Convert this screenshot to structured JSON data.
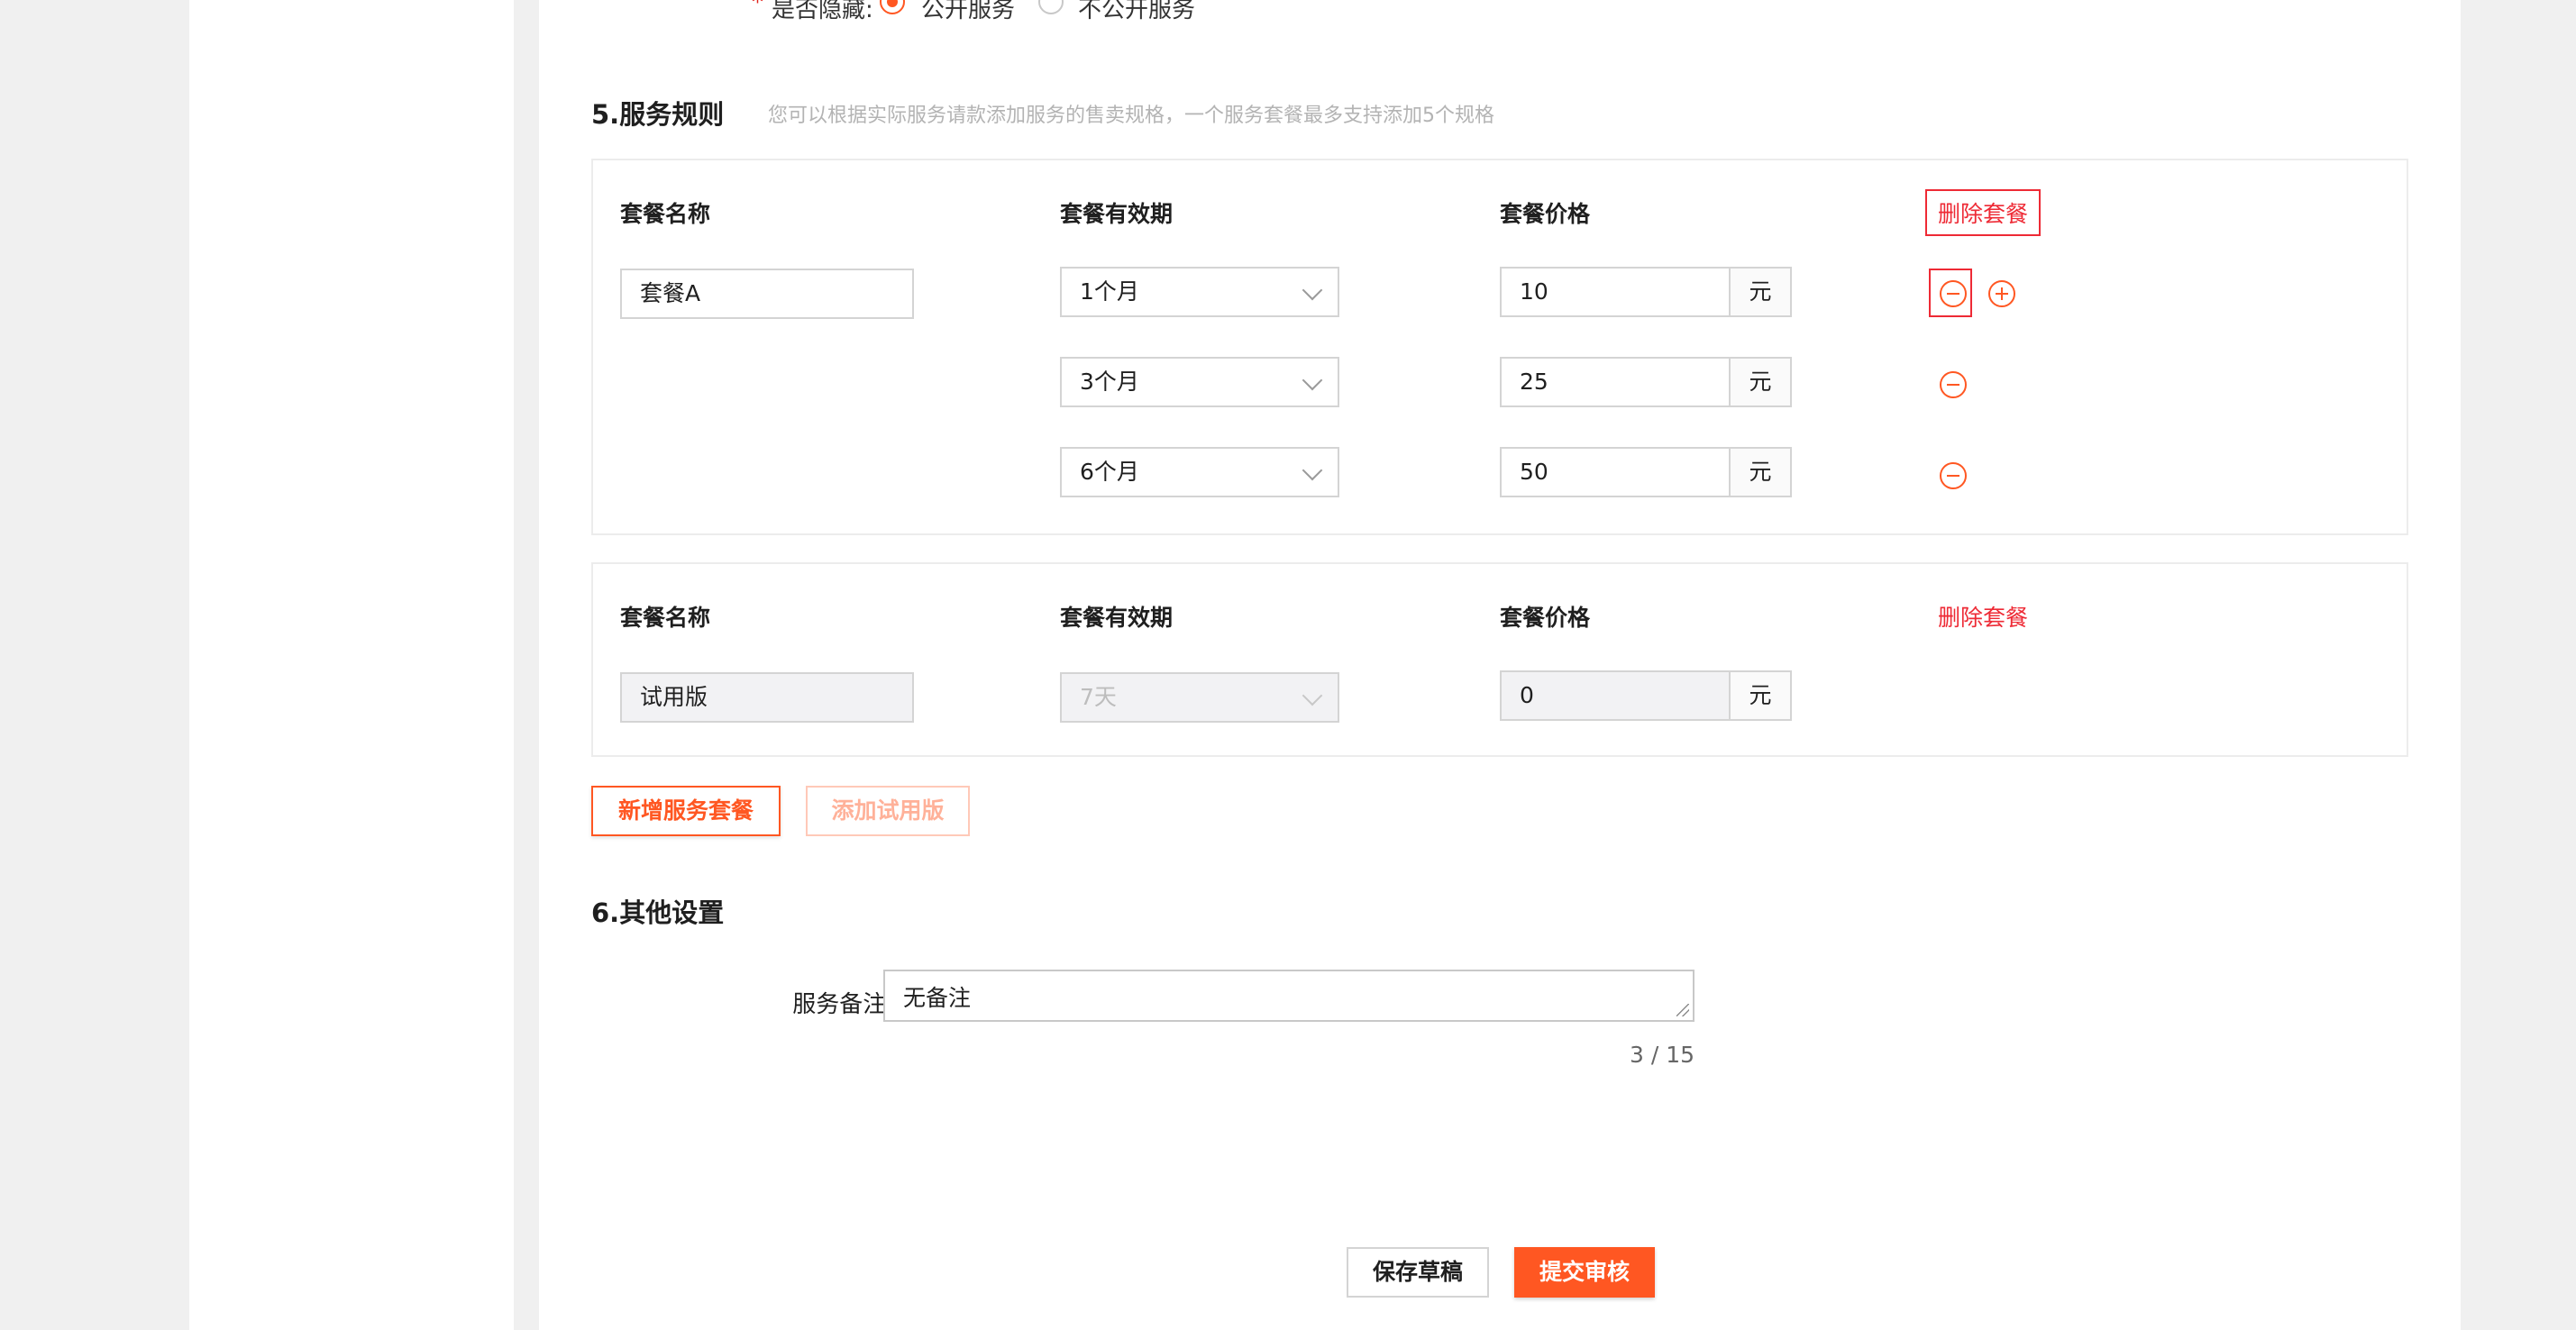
{
  "hidden_row": {
    "required_mark": "*",
    "label": "是否隐藏:",
    "options": [
      "公开服务",
      "不公开服务"
    ],
    "selected_index": 0
  },
  "section5": {
    "title": "5.服务规则",
    "hint": "您可以根据实际服务请款添加服务的售卖规格，一个服务套餐最多支持添加5个规格"
  },
  "package_a": {
    "col_name": "套餐名称",
    "col_period": "套餐有效期",
    "col_price": "套餐价格",
    "delete_label": "删除套餐",
    "name_value": "套餐A",
    "specs": [
      {
        "period": "1个月",
        "price": "10",
        "unit": "元"
      },
      {
        "period": "3个月",
        "price": "25",
        "unit": "元"
      },
      {
        "period": "6个月",
        "price": "50",
        "unit": "元"
      }
    ]
  },
  "package_trial": {
    "col_name": "套餐名称",
    "col_period": "套餐有效期",
    "col_price": "套餐价格",
    "delete_label": "删除套餐",
    "name_value": "试用版",
    "period_value": "7天",
    "price_value": "0",
    "unit": "元"
  },
  "actions": {
    "add_package": "新增服务套餐",
    "add_trial": "添加试用版"
  },
  "section6": {
    "title": "6.其他设置",
    "remark_label": "服务备注:",
    "remark_value": "无备注",
    "counter": "3 / 15"
  },
  "footer": {
    "save_draft": "保存草稿",
    "submit": "提交审核"
  },
  "colors": {
    "accent": "#ff5722",
    "danger": "#ee2a35",
    "border": "#d4d4d4",
    "background": "#f0f0f0"
  }
}
